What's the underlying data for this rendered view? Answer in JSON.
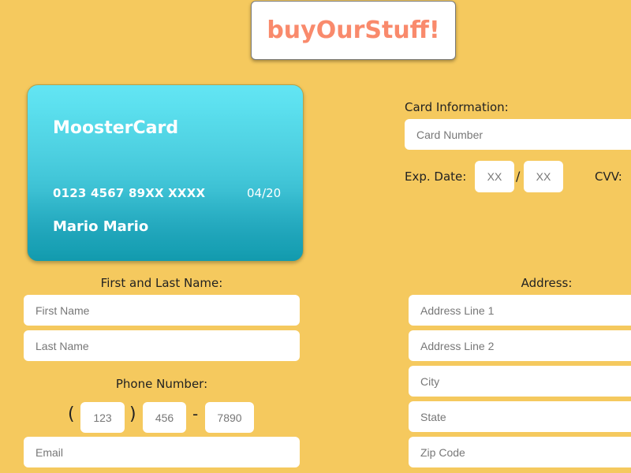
{
  "header": {
    "logo_text": "buyOurStuff!"
  },
  "card": {
    "brand": "MoosterCard",
    "number": "0123 4567 89XX XXXX",
    "expiry": "04/20",
    "holder": "Mario Mario"
  },
  "card_info": {
    "heading": "Card Information:",
    "card_number_placeholder": "Card Number",
    "exp_label": "Exp. Date:",
    "exp_month_placeholder": "XX",
    "exp_separator": "/",
    "exp_year_placeholder": "XX",
    "cvv_label": "CVV:"
  },
  "name": {
    "heading": "First and Last Name:",
    "first_placeholder": "First Name",
    "last_placeholder": "Last Name"
  },
  "phone": {
    "heading": "Phone Number:",
    "open_paren": "(",
    "close_paren": ")",
    "dash": "-",
    "area_placeholder": "123",
    "prefix_placeholder": "456",
    "line_placeholder": "7890",
    "email_placeholder": "Email"
  },
  "address": {
    "heading": "Address:",
    "line1_placeholder": "Address Line 1",
    "line2_placeholder": "Address Line 2",
    "city_placeholder": "City",
    "state_placeholder": "State",
    "zip_placeholder": "Zip Code"
  }
}
